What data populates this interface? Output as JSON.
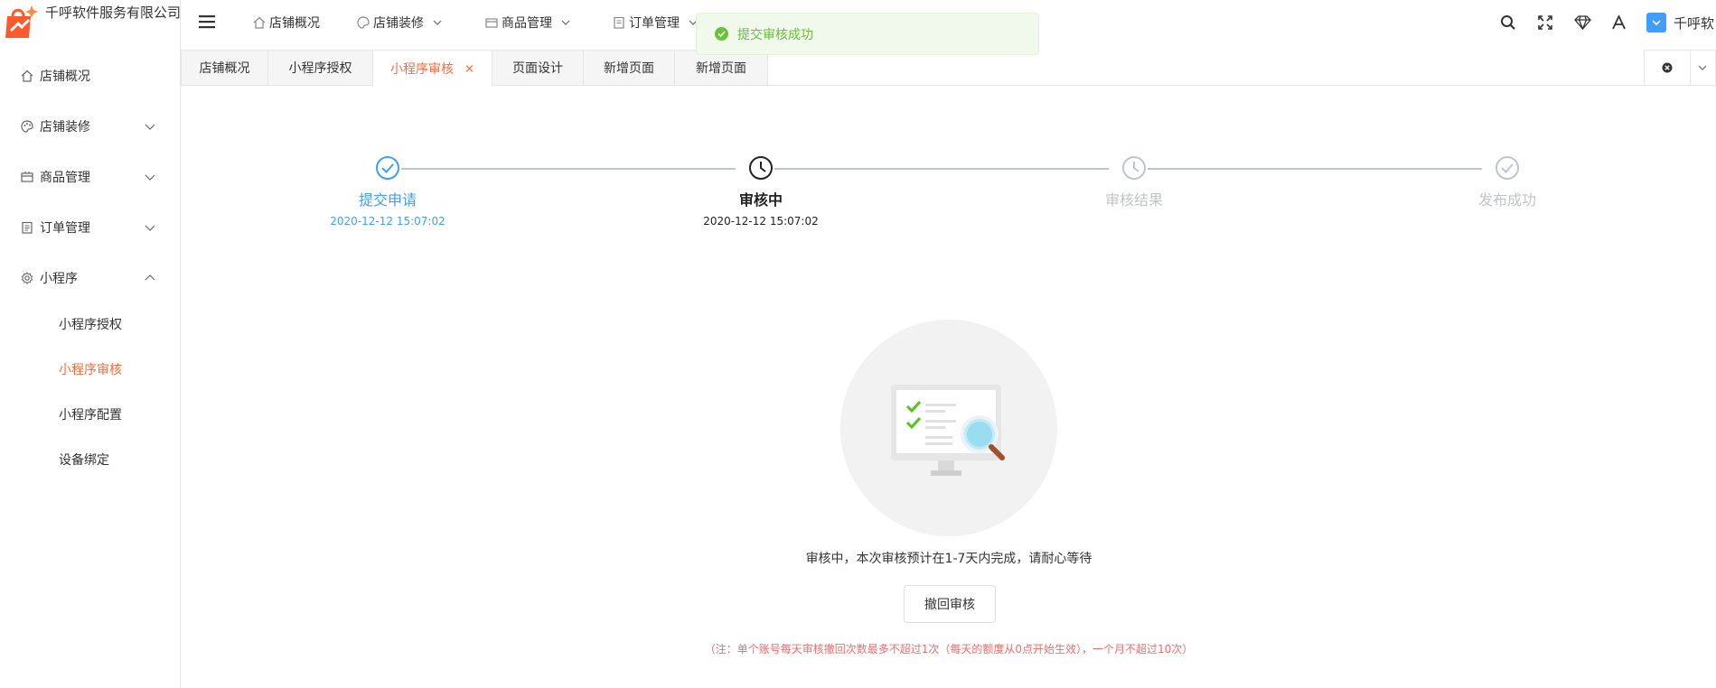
{
  "app": {
    "company_name": "千呼软件服务有限公司"
  },
  "colors": {
    "accent": "#ff6a3d",
    "success": "#67c23a",
    "primary": "#409eff",
    "danger": "#f56c6c",
    "muted": "#c0c4cc"
  },
  "sidebar": {
    "items": [
      {
        "label": "店铺概况",
        "icon": "home-icon"
      },
      {
        "label": "店铺装修",
        "icon": "palette-icon"
      },
      {
        "label": "商品管理",
        "icon": "box-icon"
      },
      {
        "label": "订单管理",
        "icon": "clipboard-icon"
      },
      {
        "label": "小程序",
        "icon": "gear-icon"
      }
    ],
    "sub_items": [
      {
        "label": "小程序授权"
      },
      {
        "label": "小程序审核"
      },
      {
        "label": "小程序配置"
      },
      {
        "label": "设备绑定"
      }
    ]
  },
  "topnav": {
    "items": [
      {
        "label": "店铺概况"
      },
      {
        "label": "店铺装修"
      },
      {
        "label": "商品管理"
      },
      {
        "label": "订单管理"
      }
    ],
    "user_name": "千呼软"
  },
  "toast": {
    "message": "提交审核成功"
  },
  "tabs": [
    {
      "label": "店铺概况"
    },
    {
      "label": "小程序授权"
    },
    {
      "label": "小程序审核",
      "close": "×"
    },
    {
      "label": "页面设计"
    },
    {
      "label": "新增页面"
    },
    {
      "label": "新增页面"
    }
  ],
  "steps": [
    {
      "title": "提交申请",
      "time": "2020-12-12 15:07:02"
    },
    {
      "title": "审核中",
      "time": "2020-12-12 15:07:02"
    },
    {
      "title": "审核结果",
      "time": ""
    },
    {
      "title": "发布成功",
      "time": ""
    }
  ],
  "review": {
    "description": "审核中，本次审核预计在1-7天内完成，请耐心等待",
    "withdraw_button": "撤回审核",
    "note": "（注：单个账号每天审核撤回次数最多不超过1次（每天的额度从0点开始生效），一个月不超过10次）"
  }
}
